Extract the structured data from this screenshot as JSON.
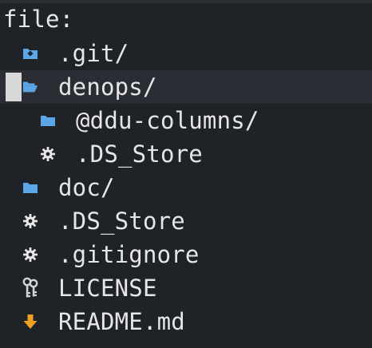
{
  "header": {
    "title": "file:"
  },
  "tree": {
    "items": [
      {
        "name": ".git/",
        "icon": "git-folder-icon"
      },
      {
        "name": "denops/",
        "icon": "folder-open-icon",
        "selected": true
      },
      {
        "name": "@ddu-columns/",
        "icon": "folder-icon"
      },
      {
        "name": ".DS_Store",
        "icon": "gear-icon"
      },
      {
        "name": "doc/",
        "icon": "folder-icon"
      },
      {
        "name": ".DS_Store",
        "icon": "gear-icon"
      },
      {
        "name": ".gitignore",
        "icon": "gear-icon"
      },
      {
        "name": "LICENSE",
        "icon": "key-icon"
      },
      {
        "name": "README.md",
        "icon": "download-arrow-icon"
      }
    ]
  },
  "colors": {
    "background": "#1f2227",
    "selected_row": "#2a2e34",
    "folder_blue": "#5aa6e6",
    "gear_white": "#e6e6e6",
    "arrow_orange": "#f0a020",
    "text": "#e6e6e6"
  }
}
